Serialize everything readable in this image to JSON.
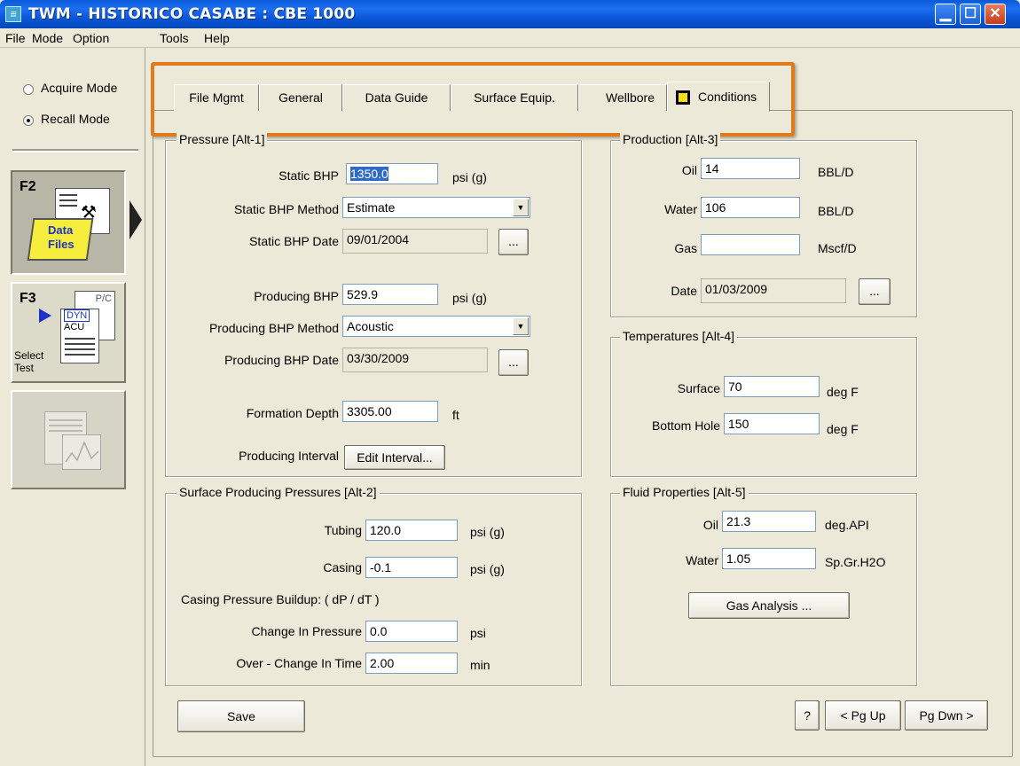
{
  "window": {
    "title": "TWM  -  HISTORICO CASABE : CBE 1000",
    "icon_glyph": "≡"
  },
  "menu": [
    "File",
    "Mode",
    "Option",
    "Tools",
    "Help"
  ],
  "left_panel": {
    "acquire_mode": "Acquire Mode",
    "recall_mode": "Recall Mode",
    "recall_mode_selected": true,
    "f2_key": "F2",
    "f2_label_line1": "Data",
    "f2_label_line2": "Files",
    "f3_key": "F3",
    "f3_label_line1": "Select",
    "f3_label_line2": "Test",
    "f3_icon_labels": [
      "P/C",
      "DYN",
      "ACU"
    ]
  },
  "tabs": [
    "File Mgmt",
    "General",
    "Data Guide",
    "Surface Equip.",
    "Wellbore",
    "Conditions"
  ],
  "active_tab": "Conditions",
  "pressure": {
    "group_title": "Pressure [Alt-1]",
    "static_bhp_label": "Static BHP",
    "static_bhp_value": "1350.0",
    "static_bhp_unit": "psi (g)",
    "static_bhp_method_label": "Static BHP Method",
    "static_bhp_method_value": "Estimate",
    "static_bhp_date_label": "Static BHP Date",
    "static_bhp_date_value": "09/01/2004",
    "producing_bhp_label": "Producing BHP",
    "producing_bhp_value": "529.9",
    "producing_bhp_unit": "psi (g)",
    "producing_bhp_method_label": "Producing BHP Method",
    "producing_bhp_method_value": "Acoustic",
    "producing_bhp_date_label": "Producing BHP Date",
    "producing_bhp_date_value": "03/30/2009",
    "formation_depth_label": "Formation Depth",
    "formation_depth_value": "3305.00",
    "formation_depth_unit": "ft",
    "producing_interval_label": "Producing Interval",
    "edit_interval_button": "Edit Interval...",
    "ellipsis": "..."
  },
  "surface_pressures": {
    "group_title": "Surface Producing Pressures [Alt-2]",
    "tubing_label": "Tubing",
    "tubing_value": "120.0",
    "tubing_unit": "psi (g)",
    "casing_label": "Casing",
    "casing_value": "-0.1",
    "casing_unit": "psi (g)",
    "buildup_label": "Casing Pressure Buildup:  ( dP / dT )",
    "change_pressure_label": "Change In Pressure",
    "change_pressure_value": "0.0",
    "change_pressure_unit": "psi",
    "change_time_label": "Over - Change In Time",
    "change_time_value": "2.00",
    "change_time_unit": "min"
  },
  "production": {
    "group_title": "Production [Alt-3]",
    "oil_label": "Oil",
    "oil_value": "14",
    "oil_unit": "BBL/D",
    "water_label": "Water",
    "water_value": "106",
    "water_unit": "BBL/D",
    "gas_label": "Gas",
    "gas_value": "",
    "gas_unit": "Mscf/D",
    "date_label": "Date",
    "date_value": "01/03/2009",
    "ellipsis": "..."
  },
  "temperatures": {
    "group_title": "Temperatures [Alt-4]",
    "surface_label": "Surface",
    "surface_value": "70",
    "surface_unit": "deg F",
    "bottom_label": "Bottom Hole",
    "bottom_value": "150",
    "bottom_unit": "deg F"
  },
  "fluid": {
    "group_title": "Fluid Properties [Alt-5]",
    "oil_label": "Oil",
    "oil_value": "21.3",
    "oil_unit": "deg.API",
    "water_label": "Water",
    "water_value": "1.05",
    "water_unit": "Sp.Gr.H2O",
    "gas_analysis_button": "Gas Analysis ..."
  },
  "footer": {
    "save": "Save",
    "help": "?",
    "pgup": "< Pg Up",
    "pgdwn": "Pg Dwn >"
  },
  "colors": {
    "highlight_box": "#e07a1f",
    "title_bar": "#0a59d8"
  }
}
